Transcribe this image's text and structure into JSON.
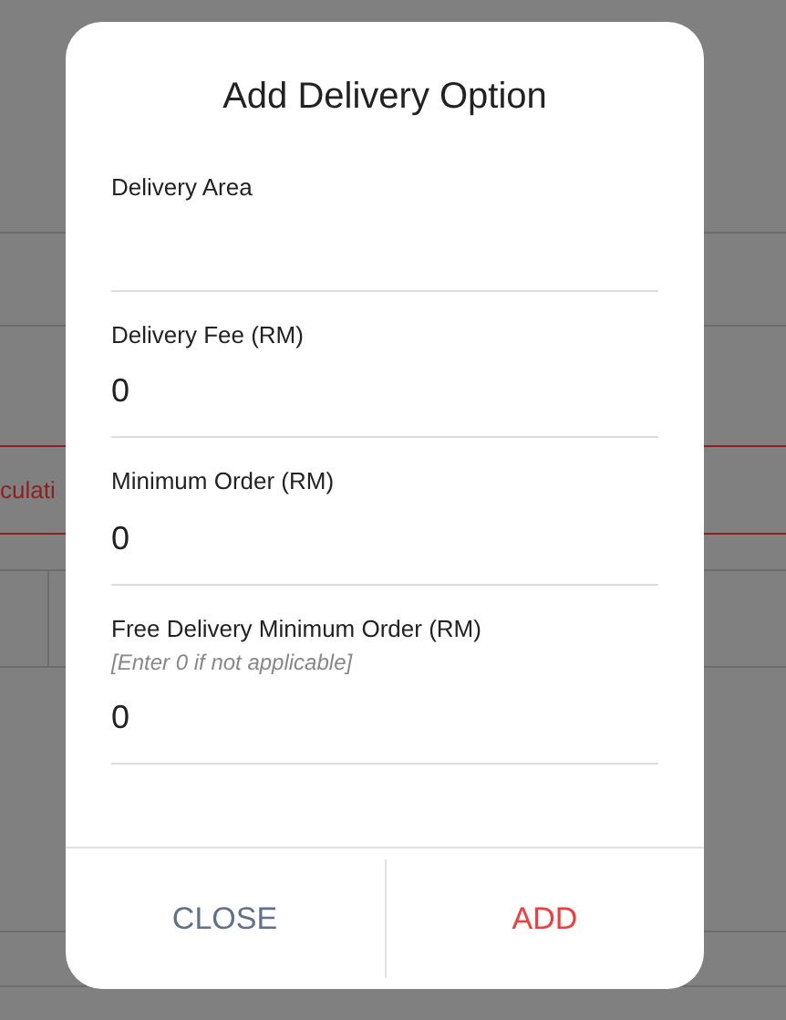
{
  "background": {
    "button_label": "culati"
  },
  "dialog": {
    "title": "Add Delivery Option",
    "fields": [
      {
        "label": "Delivery Area"
      },
      {
        "label": "Delivery Fee (RM)",
        "value": "0"
      },
      {
        "label": "Minimum Order (RM)",
        "value": "0"
      },
      {
        "label": "Free Delivery Minimum Order (RM)",
        "hint": "[Enter 0 if not applicable]",
        "value": "0"
      }
    ],
    "buttons": [
      {
        "label": "CLOSE",
        "kind": "secondary"
      },
      {
        "label": "ADD",
        "kind": "primary"
      }
    ]
  }
}
